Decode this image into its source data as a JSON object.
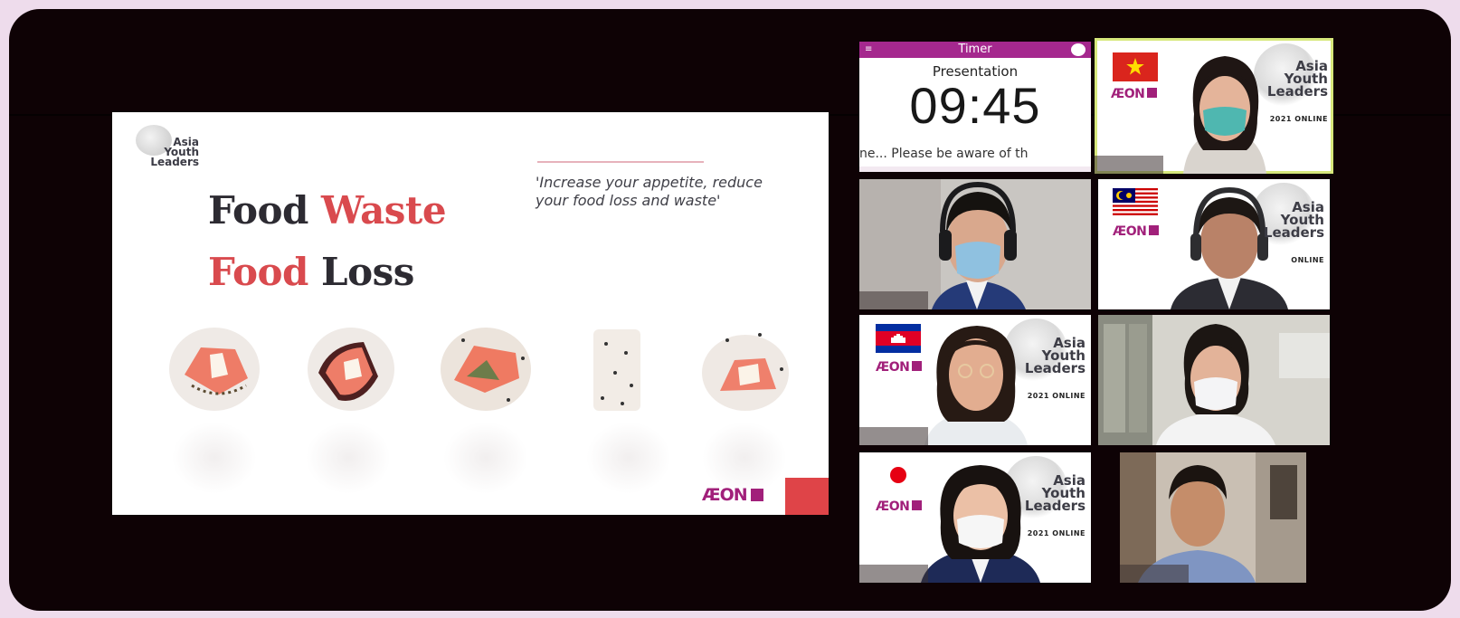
{
  "slide": {
    "logo_text": "Asia\nYouth\nLeaders",
    "title_line1": {
      "word1": "Food",
      "word2": "Waste"
    },
    "title_line2": {
      "word1": "Food",
      "word2": "Loss"
    },
    "quote": "'Increase your appetite, reduce your food loss and waste'",
    "aeon_logo": "ÆON",
    "colors": {
      "accent_red": "#d94a4e",
      "dark_text": "#2d2b32",
      "aeon_magenta": "#a1207a"
    }
  },
  "timer": {
    "title": "Timer",
    "label": "Presentation",
    "value": "09:45",
    "message": "ne... Please be aware of th"
  },
  "tiles": [
    {
      "id": "vietnam",
      "flag": "vietnam-flag-icon",
      "aeon": "ÆON",
      "branding": "Asia\nYouth\nLeaders",
      "online": "2021 ONLINE"
    },
    {
      "id": "participant-headset"
    },
    {
      "id": "malaysia",
      "flag": "malaysia-flag-icon",
      "aeon": "ÆON",
      "branding": "Asia\nYouth\nLeaders",
      "online": "ONLINE"
    },
    {
      "id": "cambodia",
      "flag": "cambodia-flag-icon",
      "aeon": "ÆON",
      "branding": "Asia\nYouth\nLeaders",
      "online": "2021 ONLINE"
    },
    {
      "id": "participant-office"
    },
    {
      "id": "japan",
      "flag": "japan-flag-icon",
      "aeon": "ÆON",
      "branding": "Asia\nYouth\nLeaders",
      "online": "2021 ONLINE"
    },
    {
      "id": "participant-room"
    }
  ]
}
